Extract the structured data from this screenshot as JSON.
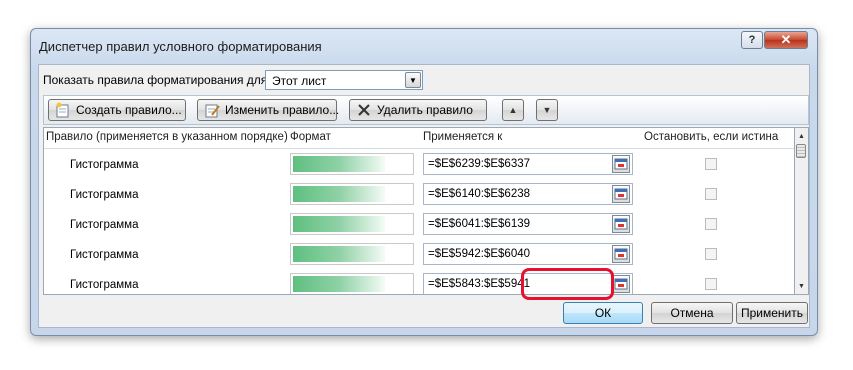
{
  "window": {
    "title": "Диспетчер правил условного форматирования"
  },
  "show_rules": {
    "label": "Показать правила форматирования для:",
    "selected": "Этот лист"
  },
  "toolbar": {
    "create_label": "Создать правило...",
    "edit_label": "Изменить правило...",
    "delete_label": "Удалить правило"
  },
  "table": {
    "headers": {
      "rule": "Правило (применяется в указанном порядке)",
      "format": "Формат",
      "applies_to": "Применяется к",
      "stop_if_true": "Остановить, если истина"
    },
    "rows": [
      {
        "rule": "Гистограмма",
        "applies_to": "=$E$6239:$E$6337",
        "stop": false
      },
      {
        "rule": "Гистограмма",
        "applies_to": "=$E$6140:$E$6238",
        "stop": false
      },
      {
        "rule": "Гистограмма",
        "applies_to": "=$E$6041:$E$6139",
        "stop": false
      },
      {
        "rule": "Гистограмма",
        "applies_to": "=$E$5942:$E$6040",
        "stop": false
      },
      {
        "rule": "Гистограмма",
        "applies_to": "=$E$5843:$E$5941",
        "stop": false
      }
    ]
  },
  "footer": {
    "ok_label": "ОК",
    "cancel_label": "Отмена",
    "apply_label": "Применить"
  },
  "colors": {
    "highlight": "#e8112d",
    "databar": "#5fbf80"
  }
}
